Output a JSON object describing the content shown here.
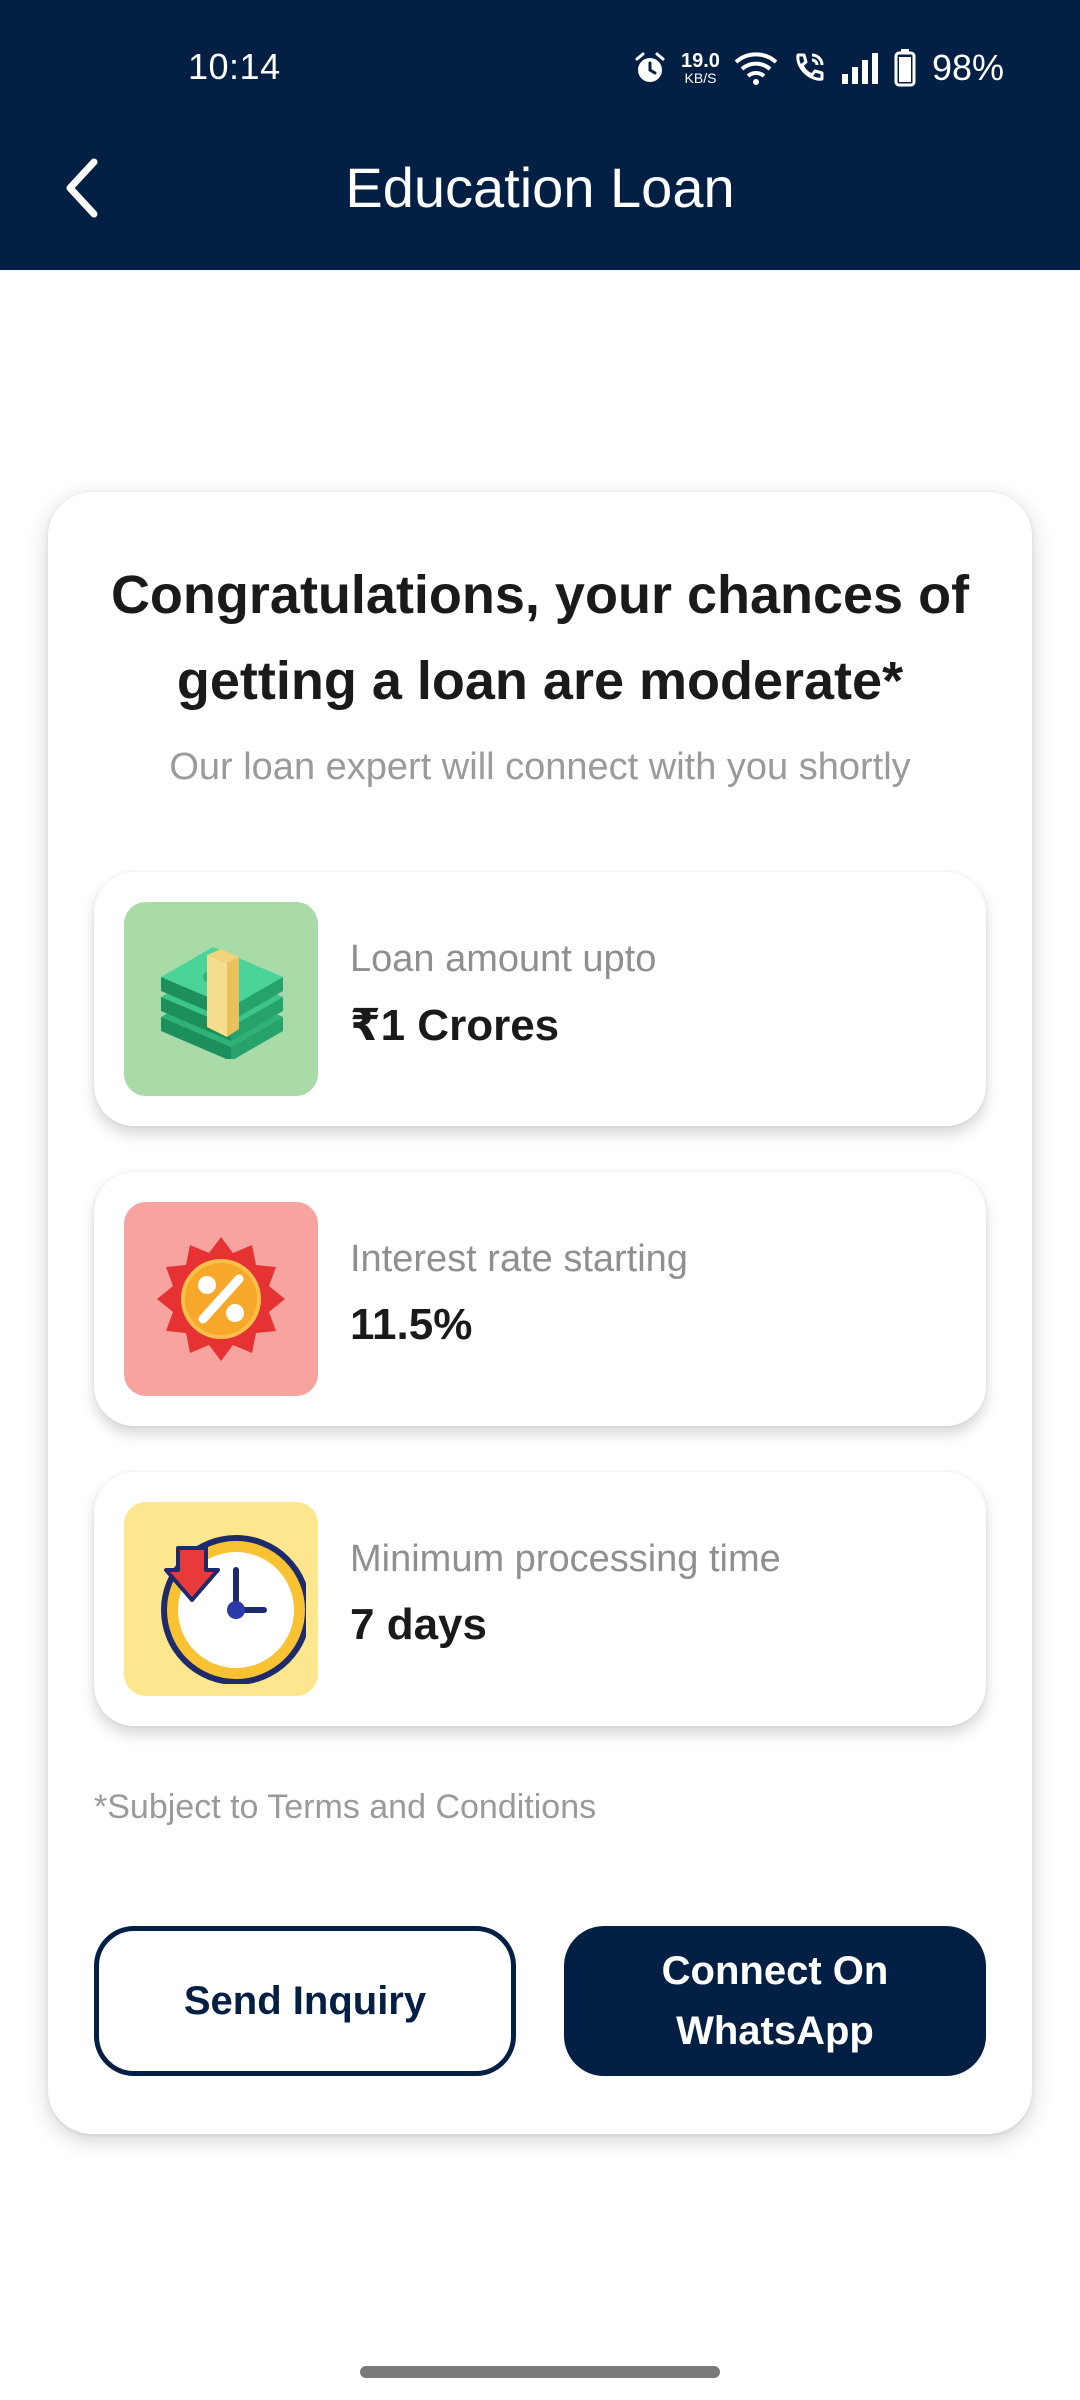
{
  "status_bar": {
    "time": "10:14",
    "net_speed_value": "19.0",
    "net_speed_unit": "KB/S",
    "battery": "98%"
  },
  "header": {
    "title": "Education Loan"
  },
  "result": {
    "headline": "Congratulations, your chances of getting a loan are moderate*",
    "subline": "Our loan expert will connect with you shortly"
  },
  "details": [
    {
      "icon": "money-stack-icon",
      "label": "Loan amount upto",
      "value": "₹1 Crores"
    },
    {
      "icon": "percent-badge-icon",
      "label": "Interest rate starting",
      "value": "11.5%"
    },
    {
      "icon": "stopwatch-icon",
      "label": "Minimum processing time",
      "value": "7 days"
    }
  ],
  "terms_note": "*Subject to Terms and Conditions",
  "actions": {
    "send_inquiry": "Send Inquiry",
    "whatsapp": "Connect On WhatsApp"
  },
  "colors": {
    "header_bg": "#041f44",
    "money_tile": "#a8dba8",
    "percent_tile": "#f7a4a1",
    "clock_tile": "#fde68d"
  }
}
